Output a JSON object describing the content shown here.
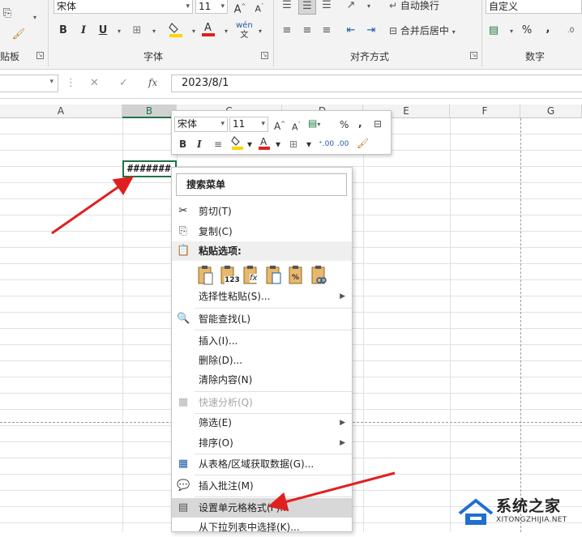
{
  "ribbon": {
    "font_name": "宋体",
    "font_size": "11",
    "wrap_text": "自动换行",
    "merge_center": "合并后居中",
    "number_format": "自定义",
    "groups": {
      "clipboard": "贴板",
      "font": "字体",
      "alignment": "对齐方式",
      "number": "数字"
    },
    "buttons": {
      "bold": "B",
      "italic": "I",
      "underline": "U",
      "percent": "%",
      "comma": ","
    }
  },
  "formula_bar": {
    "value": "2023/8/1",
    "fx_label": "fx"
  },
  "columns": [
    "A",
    "B",
    "C",
    "D",
    "E",
    "F",
    "G"
  ],
  "active_cell": {
    "column": "B",
    "display": "#######"
  },
  "mini_toolbar": {
    "font_name": "宋体",
    "font_size": "11",
    "bold": "B",
    "italic": "I",
    "percent": "%",
    "comma": ","
  },
  "context_menu": {
    "search_label": "搜索菜单",
    "items": [
      {
        "label": "剪切(T)",
        "icon": "scissors-icon"
      },
      {
        "label": "复制(C)",
        "icon": "copy-icon"
      },
      {
        "label": "粘贴选项:",
        "icon": "paste-icon"
      },
      {
        "label": "选择性粘贴(S)...",
        "icon": ""
      },
      {
        "label": "智能查找(L)",
        "icon": "smart-lookup-icon"
      },
      {
        "label": "插入(I)...",
        "icon": ""
      },
      {
        "label": "删除(D)...",
        "icon": ""
      },
      {
        "label": "清除内容(N)",
        "icon": ""
      },
      {
        "label": "快速分析(Q)",
        "icon": "quick-analysis-icon"
      },
      {
        "label": "筛选(E)",
        "icon": ""
      },
      {
        "label": "排序(O)",
        "icon": ""
      },
      {
        "label": "从表格/区域获取数据(G)...",
        "icon": "table-icon"
      },
      {
        "label": "插入批注(M)",
        "icon": "comment-icon"
      },
      {
        "label": "设置单元格格式(F)...",
        "icon": "format-cells-icon"
      },
      {
        "label": "从下拉列表中选择(K)...",
        "icon": ""
      }
    ],
    "paste_icon_labels": [
      "123",
      "fx"
    ]
  },
  "watermark": {
    "title": "系统之家",
    "url": "XITONGZHIJIA.NET"
  },
  "colors": {
    "excel_green": "#217346",
    "arrow_red": "#e02020",
    "font_color_red": "#e02020",
    "highlight_yellow": "#ffd400"
  }
}
